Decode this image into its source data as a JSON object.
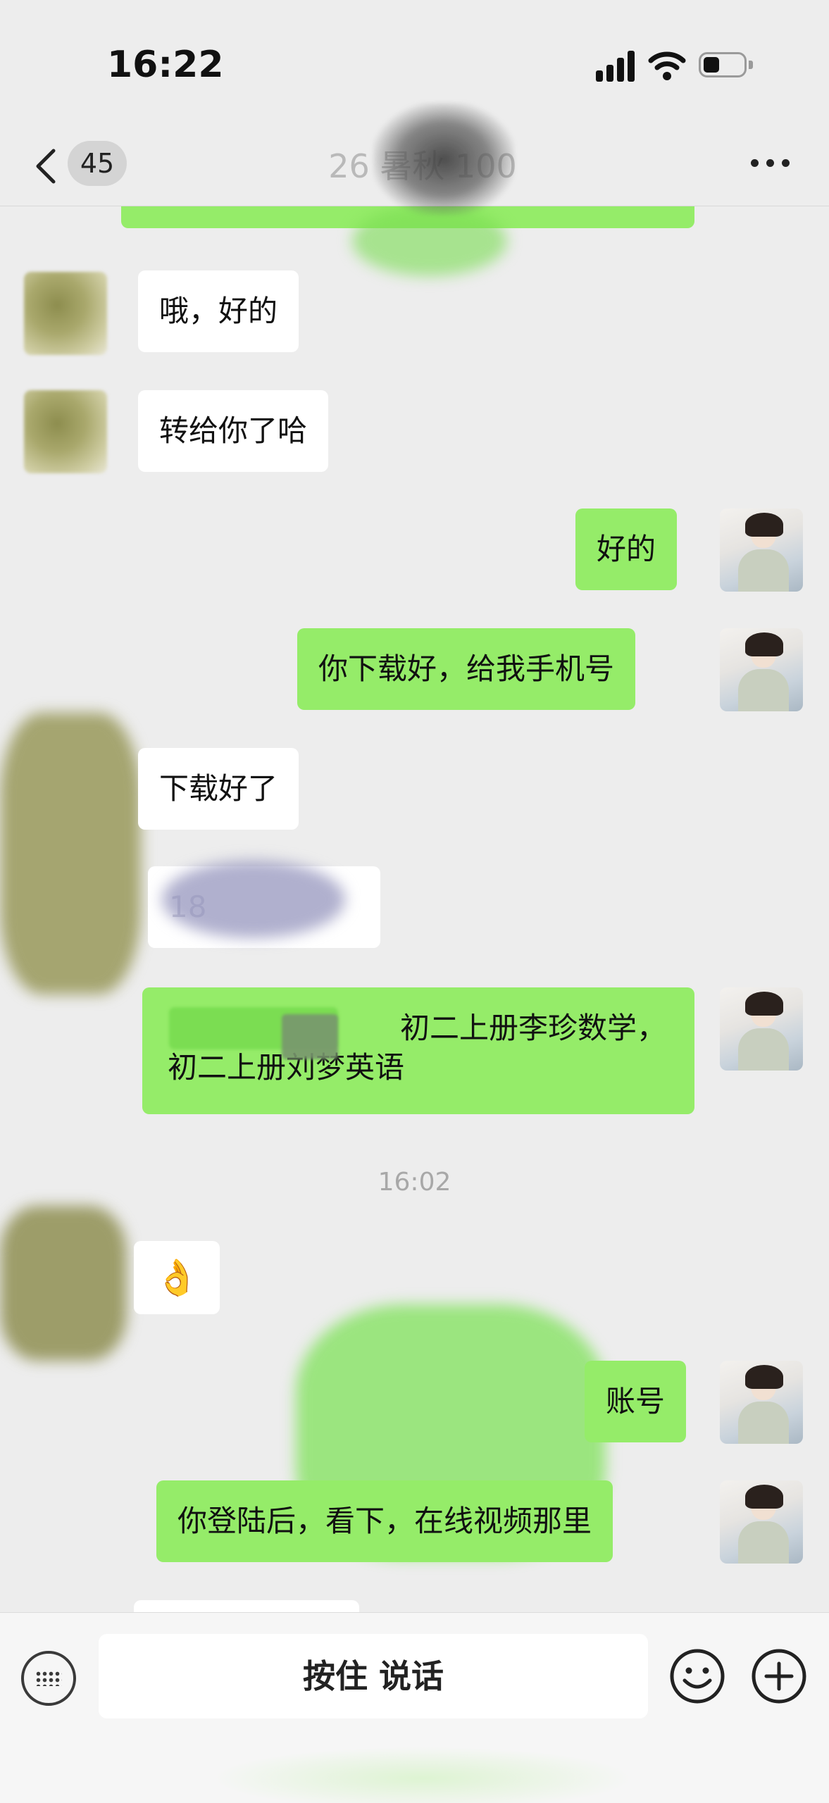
{
  "status_bar": {
    "time": "16:22"
  },
  "nav": {
    "unread_count": "45",
    "title": "26 暑秋 100"
  },
  "messages": [
    {
      "side": "in",
      "text": "哦，好的"
    },
    {
      "side": "in",
      "text": "转给你了哈"
    },
    {
      "side": "out",
      "text": "好的"
    },
    {
      "side": "out",
      "text": "你下载好，给我手机号"
    },
    {
      "side": "in",
      "text": "下载好了"
    },
    {
      "side": "in",
      "text": "18"
    },
    {
      "side": "out",
      "line1": "初二上册李珍数学，",
      "line2": "初二上册刘梦英语"
    },
    {
      "side": "in",
      "text": "👌"
    },
    {
      "side": "out",
      "text": "账号"
    },
    {
      "side": "out",
      "text": "你登陆后，看下，在线视频那里"
    }
  ],
  "time_divider": "16:02",
  "input_bar": {
    "hold_to_talk_label": "按住 说话"
  },
  "colors": {
    "background": "#ededed",
    "outgoing_bubble": "#95ec69",
    "incoming_bubble": "#ffffff"
  },
  "icons": [
    "back-chevron-icon",
    "more-dots-icon",
    "signal-icon",
    "wifi-icon",
    "battery-icon",
    "keyboard-icon",
    "emoji-icon",
    "plus-icon"
  ]
}
